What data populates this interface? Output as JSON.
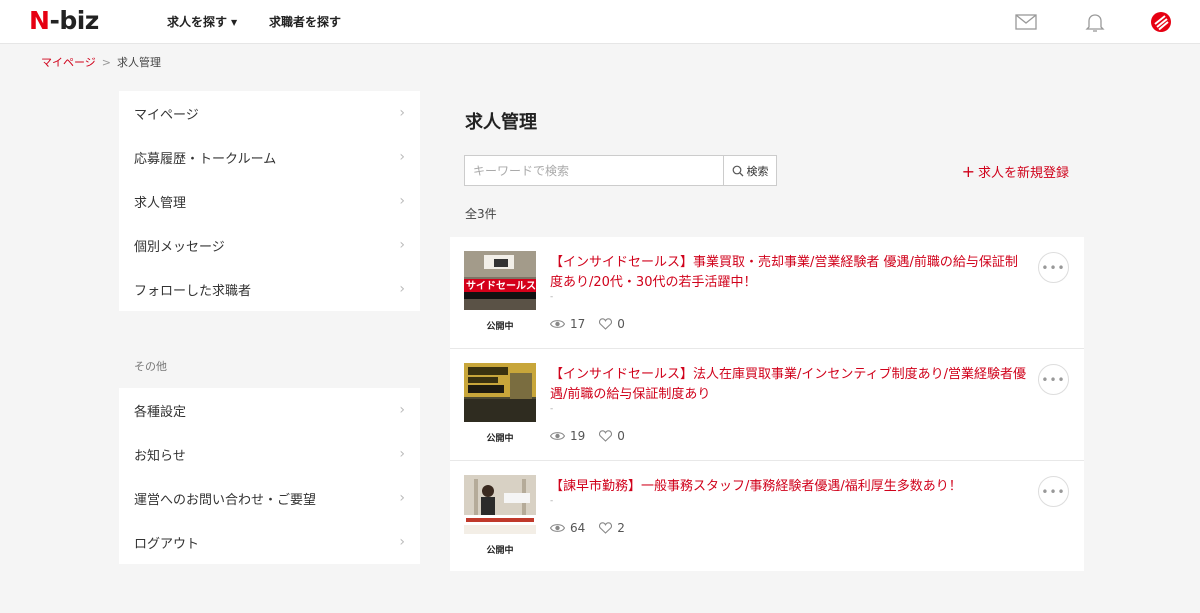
{
  "header": {
    "logo_n": "N",
    "logo_rest": "-biz",
    "nav": [
      {
        "label": "求人を探す",
        "has_caret": true
      },
      {
        "label": "求職者を探す",
        "has_caret": false
      }
    ],
    "icons": [
      "mail-icon",
      "bell-icon",
      "account-logo-icon"
    ],
    "accent_color": "#e60012"
  },
  "breadcrumb": {
    "home": "マイページ",
    "separator": ">",
    "current": "求人管理"
  },
  "sidebar": {
    "main_items": [
      {
        "label": "マイページ"
      },
      {
        "label": "応募履歴・トークルーム"
      },
      {
        "label": "求人管理"
      },
      {
        "label": "個別メッセージ"
      },
      {
        "label": "フォローした求職者"
      }
    ],
    "other_heading": "その他",
    "other_items": [
      {
        "label": "各種設定"
      },
      {
        "label": "お知らせ"
      },
      {
        "label": "運営へのお問い合わせ・ご要望"
      },
      {
        "label": "ログアウト"
      }
    ]
  },
  "main": {
    "title": "求人管理",
    "search": {
      "placeholder": "キーワードで検索",
      "value": "",
      "button_label": "検索"
    },
    "add_label": "求人を新規登録",
    "count_label": "全3件",
    "jobs": [
      {
        "title": "【インサイドセールス】事業買取・売却事業/営業経験者 優遇/前職の給与保証制度あり/20代・30代の若手活躍中！",
        "sub": "-",
        "status": "公開中",
        "views": "17",
        "likes": "0"
      },
      {
        "title": "【インサイドセールス】法人在庫買取事業/インセンティブ制度あり/営業経験者優遇/前職の給与保証制度あり",
        "sub": "-",
        "status": "公開中",
        "views": "19",
        "likes": "0"
      },
      {
        "title": "【諫早市勤務】一般事務スタッフ/事務経験者優遇/福利厚生多数あり！",
        "sub": "-",
        "status": "公開中",
        "views": "64",
        "likes": "2"
      }
    ]
  }
}
